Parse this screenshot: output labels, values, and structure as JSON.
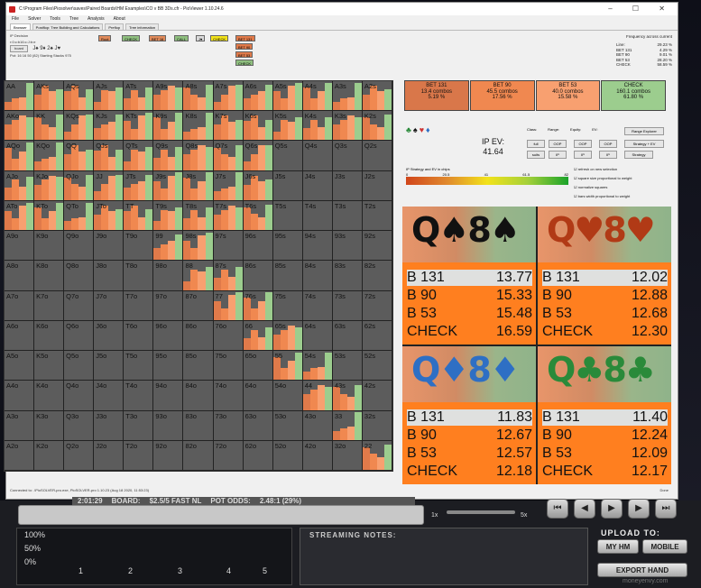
{
  "window": {
    "title": "C:\\Program Files\\Piosolver\\saves\\Paired Boards\\HM Examples\\CO v BB 3Ds.cfr - PioViewer 1.10.24.6",
    "controls": "–  ☐  ✕"
  },
  "menu": [
    "File",
    "Solver",
    "Tools",
    "Tree",
    "Analysis",
    "About"
  ],
  "tabs": [
    "Browser",
    "Postflop: Tree Building and Calculations",
    "Preflop",
    "Tree information"
  ],
  "left_panel": {
    "line1": "IP Decision",
    "line2": "r:0:c:b16:c:J:b:e",
    "board_button": "board",
    "board_cards": "J♠ 9♦ 2♠ J♥",
    "pot_line": "Pot: 16 16 50 (82) Starting Stacks 975"
  },
  "tree_buttons": [
    {
      "label": "Root",
      "bg": "#e08a5a"
    },
    {
      "label": "CHECK",
      "bg": "#8fbf7f"
    },
    {
      "label": "BET 16",
      "bg": "#e08a5a"
    },
    {
      "label": "CALL",
      "bg": "#8fbf7f"
    },
    {
      "label": "J♥",
      "bg": "#d9d9d9"
    },
    {
      "label": "CHECK",
      "bg": "#f2e21a"
    },
    {
      "label": "BET 131",
      "bg": "#e07a4a"
    },
    {
      "label": "BET 90",
      "bg": "#e07a4a"
    },
    {
      "label": "BET 53",
      "bg": "#e07a4a"
    },
    {
      "label": "CHECK",
      "bg": "#8fbf7f"
    }
  ],
  "frequency": {
    "title": "Frequency across current",
    "rows": [
      {
        "label": "Line:",
        "value": "29.23 %"
      },
      {
        "label": "BET 131",
        "value": "4.29 %"
      },
      {
        "label": "BET 90",
        "value": "9.01 %"
      },
      {
        "label": "BET 53",
        "value": "28.20 %"
      },
      {
        "label": "CHECK",
        "value": "58.59 %"
      }
    ]
  },
  "grid_labels": [
    [
      "AA",
      "AKs",
      "AQs",
      "AJs",
      "ATs",
      "A9s",
      "A8s",
      "A7s",
      "A6s",
      "A5s",
      "A4s",
      "A3s",
      "A2s"
    ],
    [
      "AKo",
      "KK",
      "KQs",
      "KJs",
      "KTs",
      "K9s",
      "K8s",
      "K7s",
      "K6s",
      "K5s",
      "K4s",
      "K3s",
      "K2s"
    ],
    [
      "AQo",
      "KQo",
      "QQ",
      "QJs",
      "QTs",
      "Q9s",
      "Q8s",
      "Q7s",
      "Q6s",
      "Q5s",
      "Q4s",
      "Q3s",
      "Q2s"
    ],
    [
      "AJo",
      "KJo",
      "QJo",
      "JJ",
      "JTs",
      "J9s",
      "J8s",
      "J7s",
      "J6s",
      "J5s",
      "J4s",
      "J3s",
      "J2s"
    ],
    [
      "ATo",
      "KTo",
      "QTo",
      "JTo",
      "TT",
      "T9s",
      "T8s",
      "T7s",
      "T6s",
      "T5s",
      "T4s",
      "T3s",
      "T2s"
    ],
    [
      "A9o",
      "K9o",
      "Q9o",
      "J9o",
      "T9o",
      "99",
      "98s",
      "97s",
      "96s",
      "95s",
      "94s",
      "93s",
      "92s"
    ],
    [
      "A8o",
      "K8o",
      "Q8o",
      "J8o",
      "T8o",
      "98o",
      "88",
      "87s",
      "86s",
      "85s",
      "84s",
      "83s",
      "82s"
    ],
    [
      "A7o",
      "K7o",
      "Q7o",
      "J7o",
      "T7o",
      "97o",
      "87o",
      "77",
      "76s",
      "75s",
      "74s",
      "73s",
      "72s"
    ],
    [
      "A6o",
      "K6o",
      "Q6o",
      "J6o",
      "T6o",
      "96o",
      "86o",
      "76o",
      "66",
      "65s",
      "64s",
      "63s",
      "62s"
    ],
    [
      "A5o",
      "K5o",
      "Q5o",
      "J5o",
      "T5o",
      "95o",
      "85o",
      "75o",
      "65o",
      "55",
      "54s",
      "53s",
      "52s"
    ],
    [
      "A4o",
      "K4o",
      "Q4o",
      "J4o",
      "T4o",
      "94o",
      "84o",
      "74o",
      "64o",
      "54o",
      "44",
      "43s",
      "42s"
    ],
    [
      "A3o",
      "K3o",
      "Q3o",
      "J3o",
      "T3o",
      "93o",
      "83o",
      "73o",
      "63o",
      "53o",
      "43o",
      "33",
      "32s"
    ],
    [
      "A2o",
      "K2o",
      "Q2o",
      "J2o",
      "T2o",
      "92o",
      "82o",
      "72o",
      "62o",
      "52o",
      "42o",
      "32o",
      "22"
    ]
  ],
  "summary": [
    {
      "title": "BET 131",
      "combos": "13.4 combos",
      "pct": "5.19 %",
      "bg": "#d9774a"
    },
    {
      "title": "BET 90",
      "combos": "45.5 combos",
      "pct": "17.56 %",
      "bg": "#f08850"
    },
    {
      "title": "BET 53",
      "combos": "40.0 combos",
      "pct": "15.58 %",
      "bg": "#f8a070"
    },
    {
      "title": "CHECK",
      "combos": "160.1 combos",
      "pct": "61.80 %",
      "bg": "#9ccd8e"
    }
  ],
  "controls": {
    "suits": "♣♠♥♦",
    "ip_ev_label": "IP EV:",
    "ip_ev_value": "41.64",
    "col_labels": [
      "Class:",
      "Range:",
      "Equity:",
      "EV:"
    ],
    "btn_full": "full",
    "btn_oop1": "OOP",
    "btn_oop2": "OOP",
    "btn_oop3": "OOP",
    "btn_suits": "suits",
    "btn_ip1": "IP",
    "btn_ip2": "IP",
    "btn_ip3": "IP",
    "range_explorer": "Range Explorer",
    "strategy_ev": "Strategy + EV",
    "strategy": "Strategy",
    "scale_label": "IP Strategy and EV in chips",
    "scale_ticks": [
      "0",
      "20.5",
      "41",
      "61.5",
      "82"
    ],
    "checkboxes": [
      "refresh on new selection",
      "square size proportional to weight",
      "normalize squares",
      "bars width proportional to weight"
    ]
  },
  "cards": [
    {
      "hand": "Q♠8♠",
      "color": "#111111",
      "rows": [
        [
          "B 131",
          "13.77"
        ],
        [
          "B 90",
          "15.33"
        ],
        [
          "B 53",
          "15.48"
        ],
        [
          "CHECK",
          "16.59"
        ]
      ]
    },
    {
      "hand": "Q♥8♥",
      "color": "#b13a16",
      "rows": [
        [
          "B 131",
          "12.02"
        ],
        [
          "B 90",
          "12.88"
        ],
        [
          "B 53",
          "12.68"
        ],
        [
          "CHECK",
          "12.30"
        ]
      ]
    },
    {
      "hand": "Q♦8♦",
      "color": "#2e6fc4",
      "rows": [
        [
          "B 131",
          "11.83"
        ],
        [
          "B 90",
          "12.67"
        ],
        [
          "B 53",
          "12.57"
        ],
        [
          "CHECK",
          "12.18"
        ]
      ]
    },
    {
      "hand": "Q♣8♣",
      "color": "#2a8a3a",
      "rows": [
        [
          "B 131",
          "11.40"
        ],
        [
          "B 90",
          "12.24"
        ],
        [
          "B 53",
          "12.09"
        ],
        [
          "CHECK",
          "12.17"
        ]
      ]
    }
  ],
  "status": "Connected to: .\\PioSOLVER-pro.exe, PioSOLVER-pro 1.10.23 (Aug 18 2020, 11:53:23)",
  "status_right": "Done",
  "player": {
    "info": [
      "2:01:29",
      "BOARD:",
      "$2.5/5 FAST NL",
      "POT ODDS:",
      "2.48:1 (29%)"
    ],
    "speed_min": "1x",
    "speed_max": "5x",
    "graph_y": [
      "100%",
      "50%",
      "0%"
    ],
    "graph_x": [
      "1",
      "2",
      "3",
      "4",
      "5"
    ],
    "notes_title": "STREAMING NOTES:",
    "upload_title": "UPLOAD TO:",
    "btn_myhm": "MY HM",
    "btn_mobile": "MOBILE",
    "btn_export": "EXPORT HAND",
    "watermark": "moneyenvy.com"
  }
}
